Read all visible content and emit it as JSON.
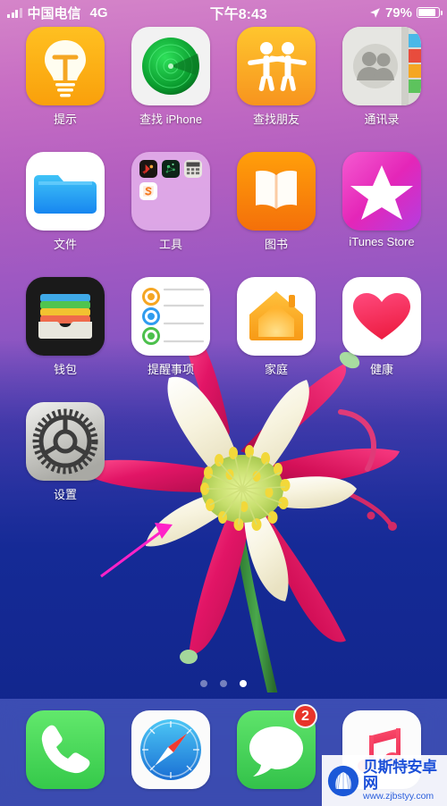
{
  "status_bar": {
    "signal_icon": "signal-bars-icon",
    "carrier": "中国电信",
    "network": "4G",
    "time": "下午8:43",
    "location_icon": "location-arrow-icon",
    "battery_percent": "79%",
    "battery_icon": "battery-icon"
  },
  "home_screen": {
    "rows": [
      [
        {
          "label": "提示",
          "icon": "tips-lightbulb-icon",
          "type": "app"
        },
        {
          "label": "查找 iPhone",
          "icon": "find-iphone-radar-icon",
          "type": "app"
        },
        {
          "label": "查找朋友",
          "icon": "find-friends-people-icon",
          "type": "app"
        },
        {
          "label": "通讯录",
          "icon": "contacts-book-icon",
          "type": "app"
        }
      ],
      [
        {
          "label": "文件",
          "icon": "files-folder-icon",
          "type": "app"
        },
        {
          "label": "工具",
          "icon": "tools-folder-icon",
          "type": "folder",
          "mini_apps": [
            "app-dark-red-icon",
            "app-dark-green-icon",
            "calculator-icon",
            "sogou-input-icon"
          ]
        },
        {
          "label": "图书",
          "icon": "books-open-book-icon",
          "type": "app"
        },
        {
          "label": "iTunes Store",
          "icon": "itunes-store-star-icon",
          "type": "app"
        }
      ],
      [
        {
          "label": "钱包",
          "icon": "wallet-cards-icon",
          "type": "app"
        },
        {
          "label": "提醒事项",
          "icon": "reminders-list-icon",
          "type": "app"
        },
        {
          "label": "家庭",
          "icon": "home-house-icon",
          "type": "app"
        },
        {
          "label": "健康",
          "icon": "health-heart-icon",
          "type": "app"
        }
      ],
      [
        {
          "label": "设置",
          "icon": "settings-gear-icon",
          "type": "app"
        }
      ]
    ]
  },
  "page_dots": {
    "count": 3,
    "active_index": 2
  },
  "dock": {
    "items": [
      {
        "label": "电话",
        "icon": "phone-handset-icon",
        "badge": ""
      },
      {
        "label": "Safari",
        "icon": "safari-compass-icon",
        "badge": ""
      },
      {
        "label": "信息",
        "icon": "messages-bubble-icon",
        "badge": "2"
      },
      {
        "label": "音乐",
        "icon": "music-note-icon",
        "badge": ""
      }
    ]
  },
  "watermark": {
    "logo_icon": "shell-logo-icon",
    "title": "贝斯特安卓网",
    "url": "www.zjbstyy.com"
  },
  "colors": {
    "background_top": "#d585c9",
    "background_bottom": "#11288f",
    "badge_red": "#e8342a",
    "dock_tint": "#7882e6",
    "accent_green": "#4cd661",
    "flower_pink": "#e0246d",
    "flower_cream": "#f6f3e2"
  }
}
